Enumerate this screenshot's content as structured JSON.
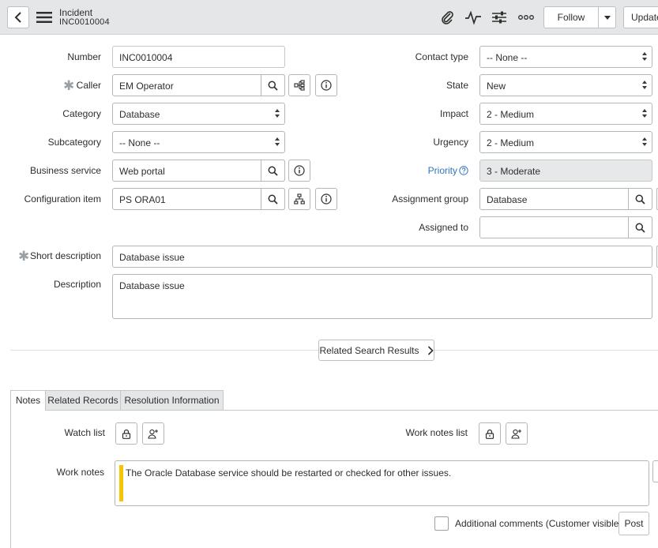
{
  "header": {
    "title": "Incident",
    "number": "INC0010004",
    "follow_label": "Follow",
    "update_label": "Update"
  },
  "fields": {
    "number": {
      "label": "Number",
      "value": "INC0010004"
    },
    "caller": {
      "label": "Caller",
      "value": "EM Operator"
    },
    "category": {
      "label": "Category",
      "value": "Database"
    },
    "subcategory": {
      "label": "Subcategory",
      "value": "-- None --"
    },
    "business_service": {
      "label": "Business service",
      "value": "Web portal"
    },
    "configuration_item": {
      "label": "Configuration item",
      "value": "PS ORA01"
    },
    "contact_type": {
      "label": "Contact type",
      "value": "-- None --"
    },
    "state": {
      "label": "State",
      "value": "New"
    },
    "impact": {
      "label": "Impact",
      "value": "2 - Medium"
    },
    "urgency": {
      "label": "Urgency",
      "value": "2 - Medium"
    },
    "priority": {
      "label": "Priority",
      "value": "3 - Moderate"
    },
    "assignment_group": {
      "label": "Assignment group",
      "value": "Database"
    },
    "assigned_to": {
      "label": "Assigned to",
      "value": ""
    },
    "short_description": {
      "label": "Short description",
      "value": "Database issue"
    },
    "description": {
      "label": "Description",
      "value": "Database issue"
    }
  },
  "related_search": {
    "label": "Related Search Results"
  },
  "tabs": [
    {
      "label": "Notes",
      "active": true
    },
    {
      "label": "Related Records",
      "active": false
    },
    {
      "label": "Resolution Information",
      "active": false
    }
  ],
  "notes": {
    "watch_list_label": "Watch list",
    "work_notes_list_label": "Work notes list",
    "work_notes_label": "Work notes",
    "work_notes_value": "The Oracle Database service should be restarted or checked for other issues.",
    "additional_comments_label": "Additional comments (Customer visible)",
    "post_label": "Post"
  },
  "colors": {
    "header_bg": "#e4e6e7",
    "priority_link": "#2f76bd",
    "work_notes_accent": "#f5c500"
  }
}
